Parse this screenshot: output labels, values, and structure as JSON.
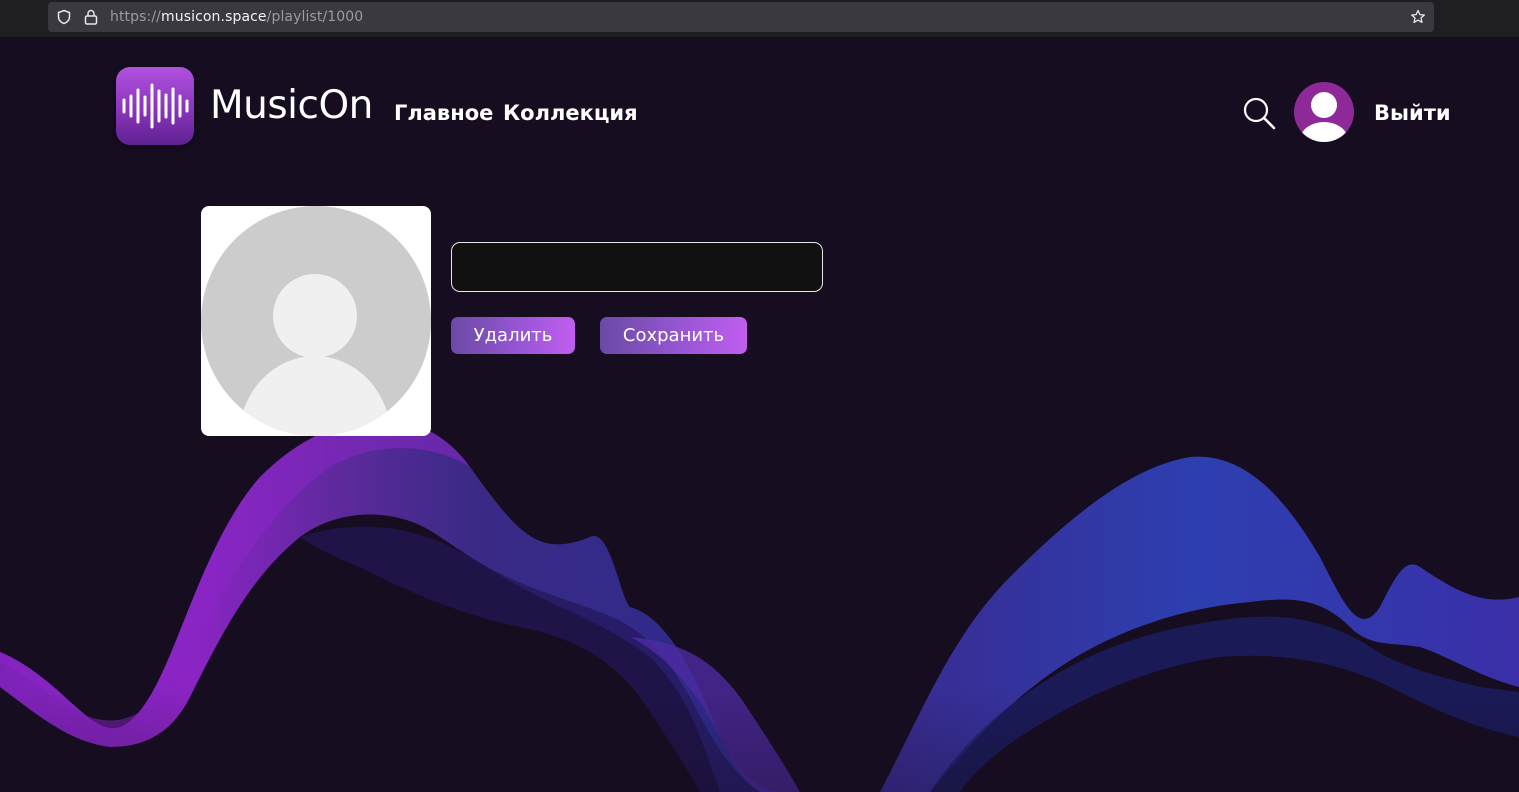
{
  "browser": {
    "url_prefix": "https://",
    "url_host": "musicon.space",
    "url_path": "/playlist/1000",
    "icons": [
      "shield-icon",
      "lock-icon",
      "star-icon"
    ]
  },
  "header": {
    "logo_text": "MusicOn",
    "nav": [
      {
        "label": "Главное"
      },
      {
        "label": "Коллекция"
      }
    ],
    "logout_label": "Выйти",
    "icons": [
      "sound-wave-logo-icon",
      "search-icon",
      "user-avatar-icon"
    ]
  },
  "playlist": {
    "name_value": "",
    "delete_label": "Удалить",
    "save_label": "Сохранить",
    "cover_icon": "user-placeholder-icon"
  },
  "colors": {
    "background": "#160d20",
    "accent_purple": "#b052e0",
    "button_gradient_start": "#6a4aa6",
    "button_gradient_end": "#c25df0",
    "avatar_bg": "#8e2a98",
    "wave_purple": "#7a1fb0",
    "wave_blue": "#2d3aa8"
  }
}
